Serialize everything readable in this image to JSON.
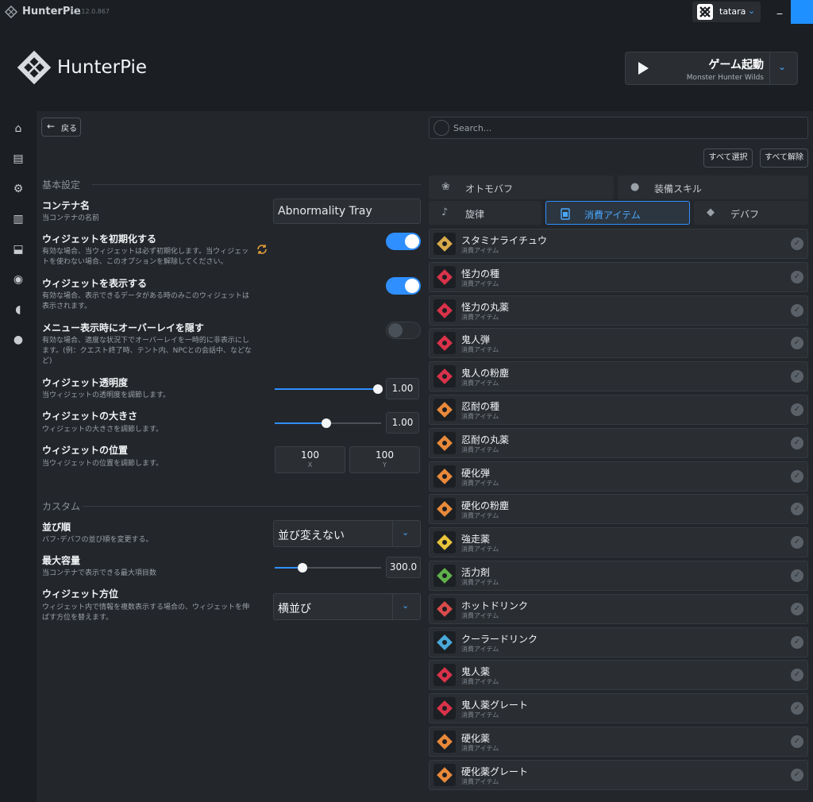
{
  "titlebar": {
    "app_name": "HunterPie",
    "version": "v2.12.0.867",
    "username": "tatara",
    "minimize_glyph": "_"
  },
  "header": {
    "brand": "HunterPie",
    "launch_title": "ゲーム起動",
    "launch_subtitle": "Monster Hunter Wilds"
  },
  "sidebar": {
    "icons": [
      "home-icon",
      "console-icon",
      "settings-icon",
      "book-icon",
      "tray-icon",
      "discord-icon",
      "patreon-icon",
      "github-icon"
    ]
  },
  "nav": {
    "back_label": "戻る"
  },
  "basic": {
    "section_title": "基本設定",
    "container_name": {
      "label": "コンテナ名",
      "desc": "当コンテナの名前",
      "value": "Abnormality Tray"
    },
    "init_widget": {
      "label": "ウィジェットを初期化する",
      "desc": "有効な場合、当ウィジェットは必ず初期化します。当ウィジェットを使わない場合、このオプションを解除してください。",
      "enabled": true
    },
    "show_widget": {
      "label": "ウィジェットを表示する",
      "desc": "有効な場合、表示できるデータがある時のみこのウィジェットは表示されます。",
      "enabled": true
    },
    "hide_overlay": {
      "label": "メニュー表示時にオーバーレイを隠す",
      "desc": "有効な場合、適度な状況下でオーバーレイを一時的に非表示にします。(例：クエスト終了時、テント内、NPCとの会話中、などなど)",
      "enabled": false
    },
    "opacity": {
      "label": "ウィジェット透明度",
      "desc": "当ウィジェットの透明度を調節します。",
      "value": "1.00",
      "fraction": 1.0
    },
    "scale": {
      "label": "ウィジェットの大きさ",
      "desc": "ウィジェットの大きさを調節します。",
      "value": "1.00",
      "fraction": 0.5
    },
    "position": {
      "label": "ウィジェットの位置",
      "desc": "当ウィジェットの位置を調節します。",
      "x_value": "100",
      "x_label": "X",
      "y_value": "100",
      "y_label": "Y"
    }
  },
  "custom": {
    "section_title": "カスタム",
    "sort": {
      "label": "並び順",
      "desc": "バフ･デバフの並び順を変更する。",
      "value": "並び変えない"
    },
    "max_capacity": {
      "label": "最大容量",
      "desc": "当コンテナで表示できる最大項目数",
      "value": "300.0",
      "fraction": 0.25
    },
    "orientation": {
      "label": "ウィジェット方位",
      "desc": "ウィジェット内で情報を複数表示する場合の、ウィジェットを伸ばす方位を替えます。",
      "value": "横並び"
    }
  },
  "right": {
    "search_placeholder": "Search...",
    "select_all": "すべて選択",
    "deselect_all": "すべて解除",
    "categories": {
      "otomo": "オトモバフ",
      "skills": "装備スキル",
      "melody": "旋律",
      "consumables": "消費アイテム",
      "debuffs": "デバフ"
    },
    "items": [
      {
        "name": "スタミナライチュウ",
        "sub": "消費アイテム",
        "color": "#d8a94a"
      },
      {
        "name": "怪力の種",
        "sub": "消費アイテム",
        "color": "#d9324a"
      },
      {
        "name": "怪力の丸薬",
        "sub": "消費アイテム",
        "color": "#d9324a"
      },
      {
        "name": "鬼人弾",
        "sub": "消費アイテム",
        "color": "#d9324a"
      },
      {
        "name": "鬼人の粉塵",
        "sub": "消費アイテム",
        "color": "#d9324a"
      },
      {
        "name": "忍耐の種",
        "sub": "消費アイテム",
        "color": "#e8893a"
      },
      {
        "name": "忍耐の丸薬",
        "sub": "消費アイテム",
        "color": "#e8893a"
      },
      {
        "name": "硬化弾",
        "sub": "消費アイテム",
        "color": "#e8893a"
      },
      {
        "name": "硬化の粉塵",
        "sub": "消費アイテム",
        "color": "#e8893a"
      },
      {
        "name": "強走薬",
        "sub": "消費アイテム",
        "color": "#e8c53a"
      },
      {
        "name": "活力剤",
        "sub": "消費アイテム",
        "color": "#5fb04a"
      },
      {
        "name": "ホットドリンク",
        "sub": "消費アイテム",
        "color": "#d94a4a"
      },
      {
        "name": "クーラードリンク",
        "sub": "消費アイテム",
        "color": "#4aa8d9"
      },
      {
        "name": "鬼人薬",
        "sub": "消費アイテム",
        "color": "#d9324a"
      },
      {
        "name": "鬼人薬グレート",
        "sub": "消費アイテム",
        "color": "#d9324a"
      },
      {
        "name": "硬化薬",
        "sub": "消費アイテム",
        "color": "#e8893a"
      },
      {
        "name": "硬化薬グレート",
        "sub": "消費アイテム",
        "color": "#e8893a"
      }
    ]
  },
  "colors": {
    "accent": "#2f8fff",
    "toggle_off": "#3a3f45",
    "sync_icon": "#e8a33a"
  }
}
